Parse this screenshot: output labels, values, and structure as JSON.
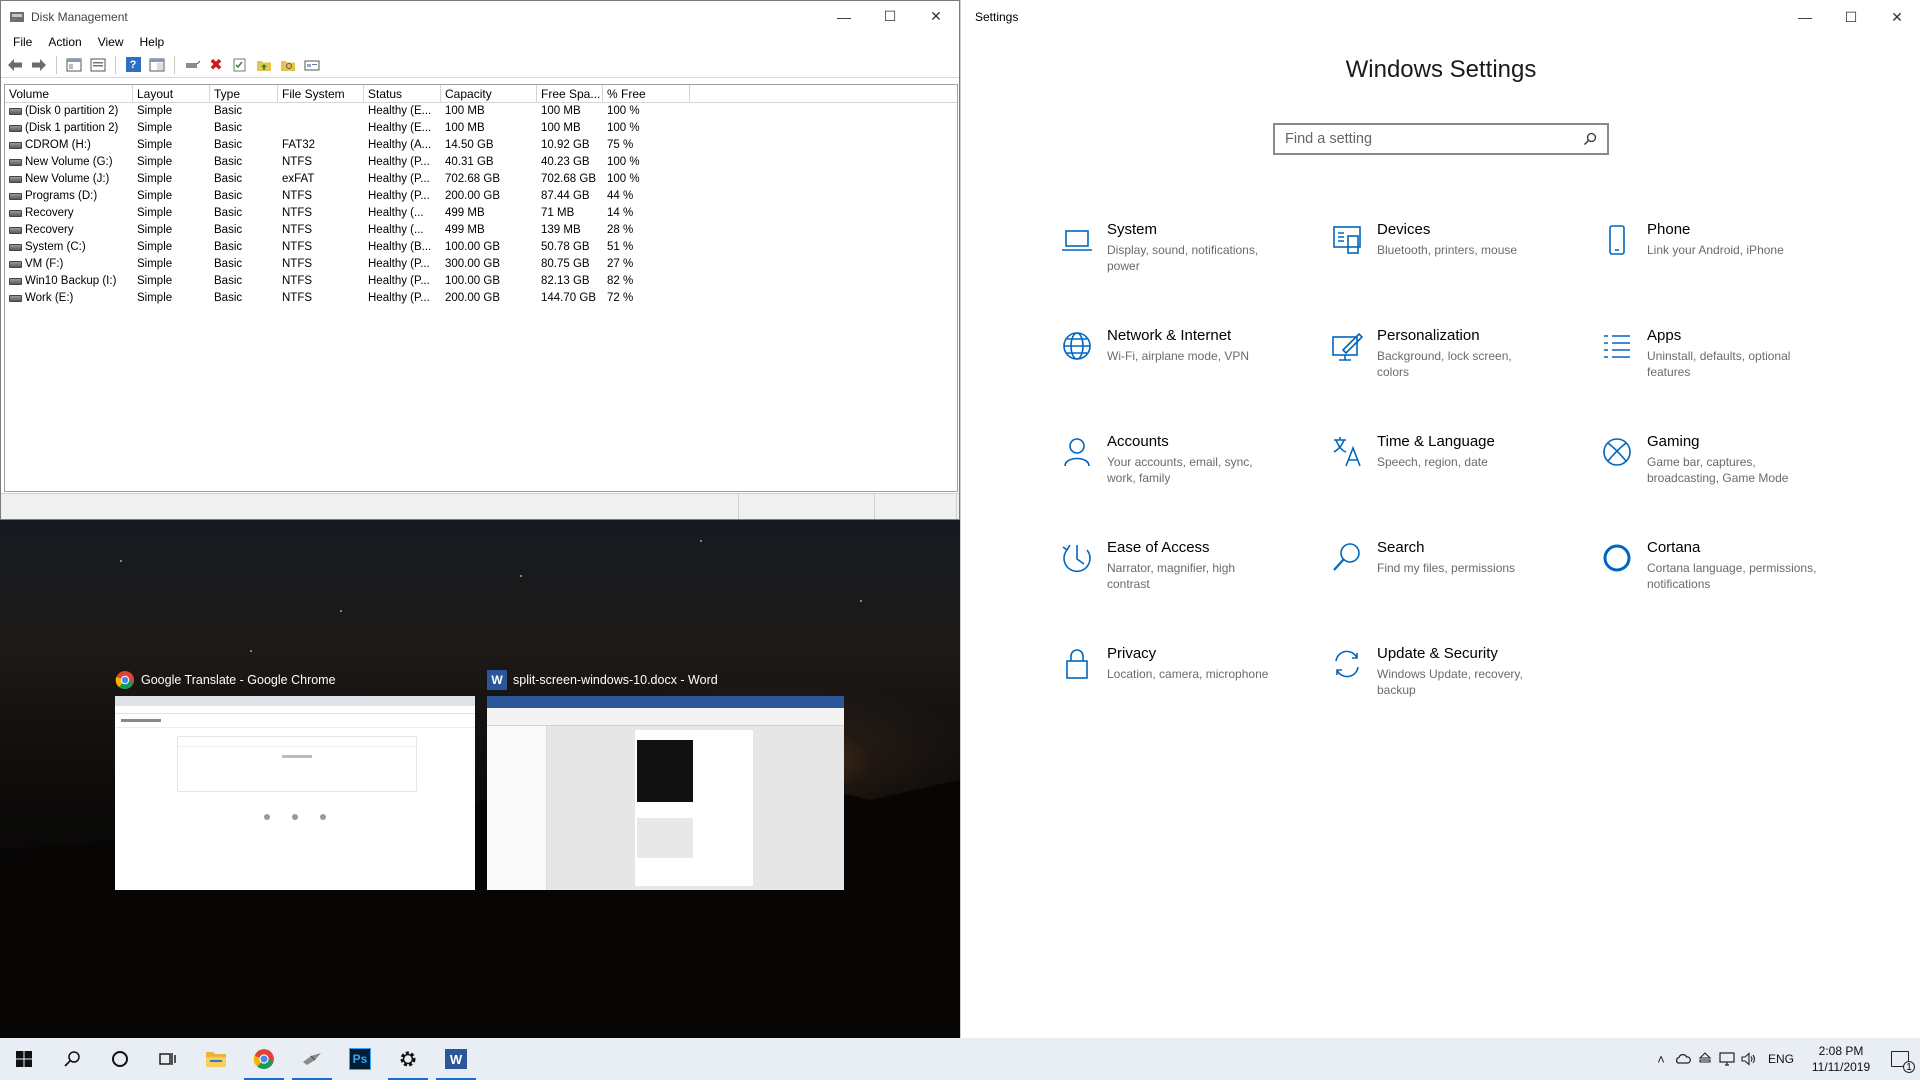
{
  "disk_management": {
    "title": "Disk Management",
    "menu": [
      "File",
      "Action",
      "View",
      "Help"
    ],
    "columns": [
      "Volume",
      "Layout",
      "Type",
      "File System",
      "Status",
      "Capacity",
      "Free Spa...",
      "% Free"
    ],
    "rows": [
      [
        "(Disk 0 partition 2)",
        "Simple",
        "Basic",
        "",
        "Healthy (E...",
        "100 MB",
        "100 MB",
        "100 %"
      ],
      [
        "(Disk 1 partition 2)",
        "Simple",
        "Basic",
        "",
        "Healthy (E...",
        "100 MB",
        "100 MB",
        "100 %"
      ],
      [
        "CDROM (H:)",
        "Simple",
        "Basic",
        "FAT32",
        "Healthy (A...",
        "14.50 GB",
        "10.92 GB",
        "75 %"
      ],
      [
        "New Volume (G:)",
        "Simple",
        "Basic",
        "NTFS",
        "Healthy (P...",
        "40.31 GB",
        "40.23 GB",
        "100 %"
      ],
      [
        "New Volume (J:)",
        "Simple",
        "Basic",
        "exFAT",
        "Healthy (P...",
        "702.68 GB",
        "702.68 GB",
        "100 %"
      ],
      [
        "Programs (D:)",
        "Simple",
        "Basic",
        "NTFS",
        "Healthy (P...",
        "200.00 GB",
        "87.44 GB",
        "44 %"
      ],
      [
        "Recovery",
        "Simple",
        "Basic",
        "NTFS",
        "Healthy (...",
        "499 MB",
        "71 MB",
        "14 %"
      ],
      [
        "Recovery",
        "Simple",
        "Basic",
        "NTFS",
        "Healthy (...",
        "499 MB",
        "139 MB",
        "28 %"
      ],
      [
        "System (C:)",
        "Simple",
        "Basic",
        "NTFS",
        "Healthy (B...",
        "100.00 GB",
        "50.78 GB",
        "51 %"
      ],
      [
        "VM (F:)",
        "Simple",
        "Basic",
        "NTFS",
        "Healthy (P...",
        "300.00 GB",
        "80.75 GB",
        "27 %"
      ],
      [
        "Win10 Backup (I:)",
        "Simple",
        "Basic",
        "NTFS",
        "Healthy (P...",
        "100.00 GB",
        "82.13 GB",
        "82 %"
      ],
      [
        "Work (E:)",
        "Simple",
        "Basic",
        "NTFS",
        "Healthy (P...",
        "200.00 GB",
        "144.70 GB",
        "72 %"
      ]
    ]
  },
  "snap_assist": {
    "cards": [
      {
        "title": "Google Translate - Google Chrome",
        "icon": "chrome-icon"
      },
      {
        "title": "split-screen-windows-10.docx - Word",
        "icon": "word-icon"
      }
    ]
  },
  "settings": {
    "window_title": "Settings",
    "heading": "Windows Settings",
    "search_placeholder": "Find a setting",
    "tiles": [
      {
        "name": "System",
        "desc": "Display, sound, notifications, power",
        "icon": "laptop-icon"
      },
      {
        "name": "Devices",
        "desc": "Bluetooth, printers, mouse",
        "icon": "devices-icon"
      },
      {
        "name": "Phone",
        "desc": "Link your Android, iPhone",
        "icon": "phone-icon"
      },
      {
        "name": "Network & Internet",
        "desc": "Wi-Fi, airplane mode, VPN",
        "icon": "globe-icon"
      },
      {
        "name": "Personalization",
        "desc": "Background, lock screen, colors",
        "icon": "personalization-icon"
      },
      {
        "name": "Apps",
        "desc": "Uninstall, defaults, optional features",
        "icon": "apps-list-icon"
      },
      {
        "name": "Accounts",
        "desc": "Your accounts, email, sync, work, family",
        "icon": "person-icon"
      },
      {
        "name": "Time & Language",
        "desc": "Speech, region, date",
        "icon": "time-language-icon"
      },
      {
        "name": "Gaming",
        "desc": "Game bar, captures, broadcasting, Game Mode",
        "icon": "xbox-icon"
      },
      {
        "name": "Ease of Access",
        "desc": "Narrator, magnifier, high contrast",
        "icon": "ease-of-access-icon"
      },
      {
        "name": "Search",
        "desc": "Find my files, permissions",
        "icon": "search-icon"
      },
      {
        "name": "Cortana",
        "desc": "Cortana language, permissions, notifications",
        "icon": "cortana-icon"
      },
      {
        "name": "Privacy",
        "desc": "Location, camera, microphone",
        "icon": "lock-icon"
      },
      {
        "name": "Update & Security",
        "desc": "Windows Update, recovery, backup",
        "icon": "update-icon"
      }
    ]
  },
  "taskbar": {
    "language": "ENG",
    "time": "2:08 PM",
    "date": "11/11/2019",
    "notification_count": "1",
    "apps": [
      "start-icon",
      "search-icon",
      "cortana-circle-icon",
      "task-view-icon",
      "file-explorer-icon",
      "chrome-icon",
      "app-icon",
      "photoshop-icon",
      "settings-gear-icon",
      "word-icon"
    ],
    "photoshop_label": "Ps",
    "word_label": "W"
  },
  "colors": {
    "accent": "#0067c0",
    "taskbar": "#e8eef4",
    "muted_text": "#6b6b6b"
  }
}
